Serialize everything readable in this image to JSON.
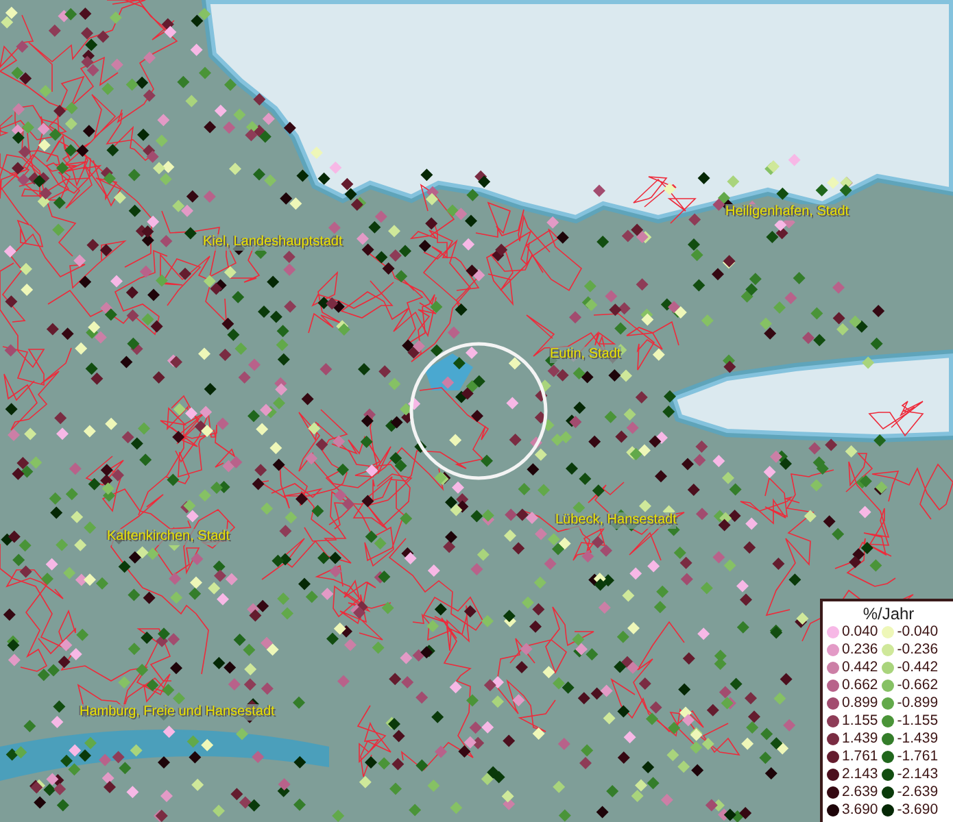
{
  "map": {
    "place_labels": [
      {
        "text": "Heiligenhafen, Stadt"
      },
      {
        "text": "Kiel, Landeshauptstadt"
      },
      {
        "text": "Eutin, Stadt"
      },
      {
        "text": "Lübeck, Hansestadt"
      },
      {
        "text": "Kaltenkirchen, Stadt"
      },
      {
        "text": "Hamburg, Freie und Hansestadt"
      }
    ]
  },
  "legend": {
    "title": "%/Jahr",
    "items": [
      {
        "label": "0.040",
        "color": "#f7b8e6"
      },
      {
        "label": "-0.040",
        "color": "#eef7b8"
      },
      {
        "label": "0.236",
        "color": "#e39ac6"
      },
      {
        "label": "-0.236",
        "color": "#cfe89a"
      },
      {
        "label": "0.442",
        "color": "#cc7fa6"
      },
      {
        "label": "-0.442",
        "color": "#a9d47c"
      },
      {
        "label": "0.662",
        "color": "#b8628a"
      },
      {
        "label": "-0.662",
        "color": "#86c164"
      },
      {
        "label": "0.899",
        "color": "#a24c6f"
      },
      {
        "label": "-0.899",
        "color": "#62a94a"
      },
      {
        "label": "1.155",
        "color": "#8e3c57"
      },
      {
        "label": "-1.155",
        "color": "#4a9438"
      },
      {
        "label": "1.439",
        "color": "#7a2c42"
      },
      {
        "label": "-1.439",
        "color": "#347d2a"
      },
      {
        "label": "1.761",
        "color": "#641c2e"
      },
      {
        "label": "-1.761",
        "color": "#20661c"
      },
      {
        "label": "2.143",
        "color": "#4c0f1e"
      },
      {
        "label": "-2.143",
        "color": "#124d10"
      },
      {
        "label": "2.639",
        "color": "#350812"
      },
      {
        "label": "-2.639",
        "color": "#0a3a0a"
      },
      {
        "label": "3.690",
        "color": "#1e0409"
      },
      {
        "label": "-3.690",
        "color": "#052805"
      }
    ]
  }
}
